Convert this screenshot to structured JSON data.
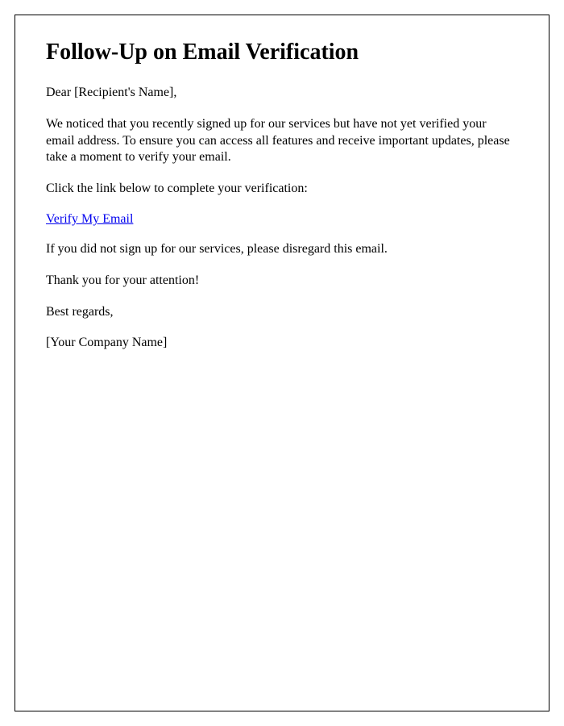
{
  "title": "Follow-Up on Email Verification",
  "greeting": "Dear [Recipient's Name],",
  "body1": "We noticed that you recently signed up for our services but have not yet verified your email address. To ensure you can access all features and receive important updates, please take a moment to verify your email.",
  "body2": "Click the link below to complete your verification:",
  "link_text": "Verify My Email",
  "body3": "If you did not sign up for our services, please disregard this email.",
  "thank_you": "Thank you for your attention!",
  "closing": "Best regards,",
  "signature": "[Your Company Name]"
}
